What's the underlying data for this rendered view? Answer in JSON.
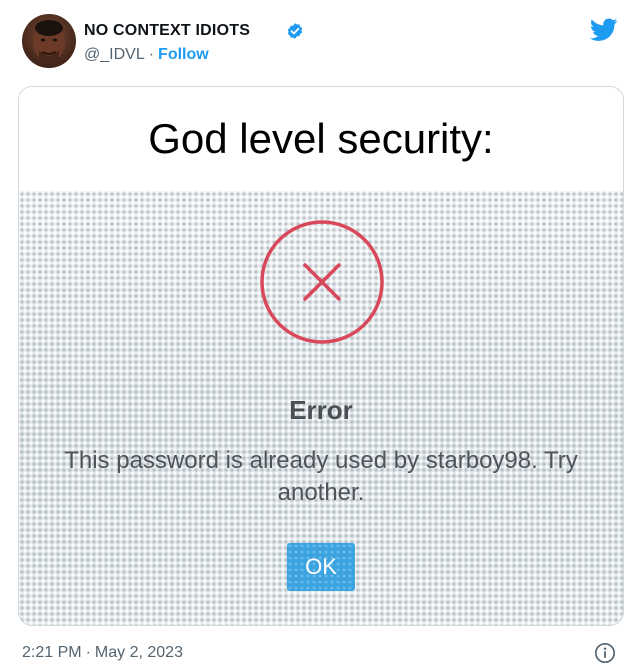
{
  "tweet": {
    "author": {
      "display_name": "NO CONTEXT IDIOTS",
      "handle": "@_IDVL",
      "separator": "·",
      "follow_label": "Follow",
      "verified_icon": "verified-badge-icon",
      "avatar": "avatar-photo"
    },
    "platform_icon": "twitter-bird-icon",
    "media": {
      "caption": "God level security:",
      "dialog": {
        "icon": "error-x-circle-icon",
        "title": "Error",
        "message": "This password is already used by starboy98. Try another.",
        "ok_label": "OK"
      }
    },
    "footer": {
      "time": "2:21 PM",
      "separator": "·",
      "date": "May 2, 2023",
      "info_icon": "info-icon"
    }
  },
  "colors": {
    "twitter_blue": "#1d9bf0",
    "secondary_text": "#536471",
    "error_red": "#d9475a",
    "ok_button": "#3aa3e0"
  }
}
